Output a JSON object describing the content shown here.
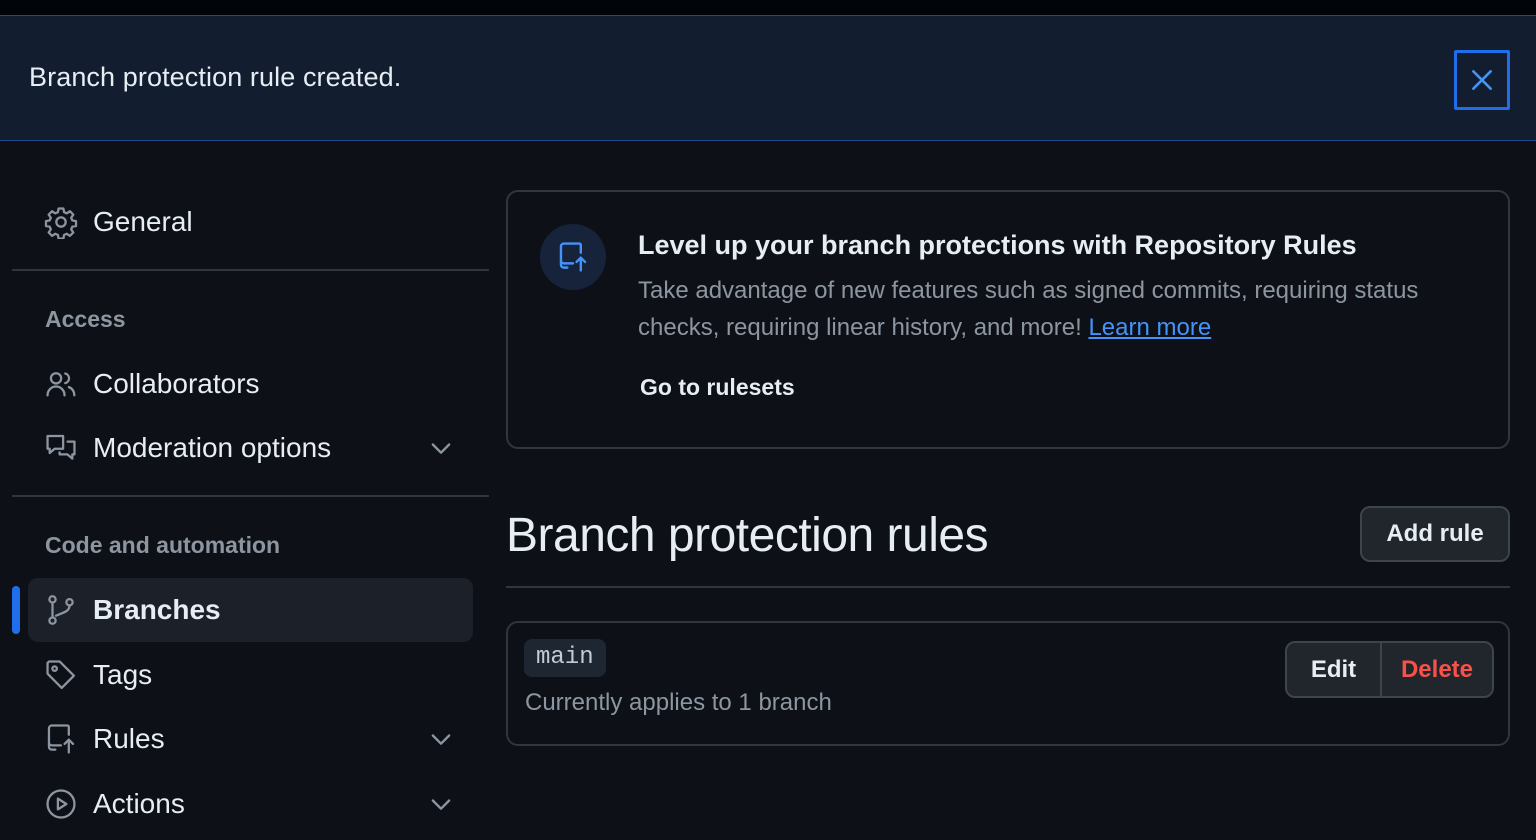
{
  "flash": {
    "message": "Branch protection rule created.",
    "close_icon": "x-icon"
  },
  "sidebar": {
    "general": {
      "label": "General",
      "icon": "gear-icon"
    },
    "sections": [
      {
        "heading": "Access",
        "items": [
          {
            "label": "Collaborators",
            "icon": "people-icon"
          },
          {
            "label": "Moderation options",
            "icon": "comment-discussion-icon",
            "expandable": true
          }
        ]
      },
      {
        "heading": "Code and automation",
        "items": [
          {
            "label": "Branches",
            "icon": "git-branch-icon",
            "active": true
          },
          {
            "label": "Tags",
            "icon": "tag-icon"
          },
          {
            "label": "Rules",
            "icon": "repo-push-icon",
            "expandable": true
          },
          {
            "label": "Actions",
            "icon": "play-icon",
            "expandable": true
          }
        ]
      }
    ]
  },
  "banner": {
    "icon": "repo-push-icon",
    "title": "Level up your branch protections with Repository Rules",
    "description": "Take advantage of new features such as signed commits, requiring status checks, requiring linear history, and more!",
    "learn_more": "Learn more",
    "cta": "Go to rulesets"
  },
  "main": {
    "title": "Branch protection rules",
    "add_rule": "Add rule",
    "rules": [
      {
        "branch": "main",
        "applies": "Currently applies to 1 branch",
        "edit": "Edit",
        "delete": "Delete"
      }
    ]
  },
  "colors": {
    "accent": "#1f6feb",
    "link": "#4493f8",
    "danger": "#f85149",
    "background": "#0d1117"
  }
}
